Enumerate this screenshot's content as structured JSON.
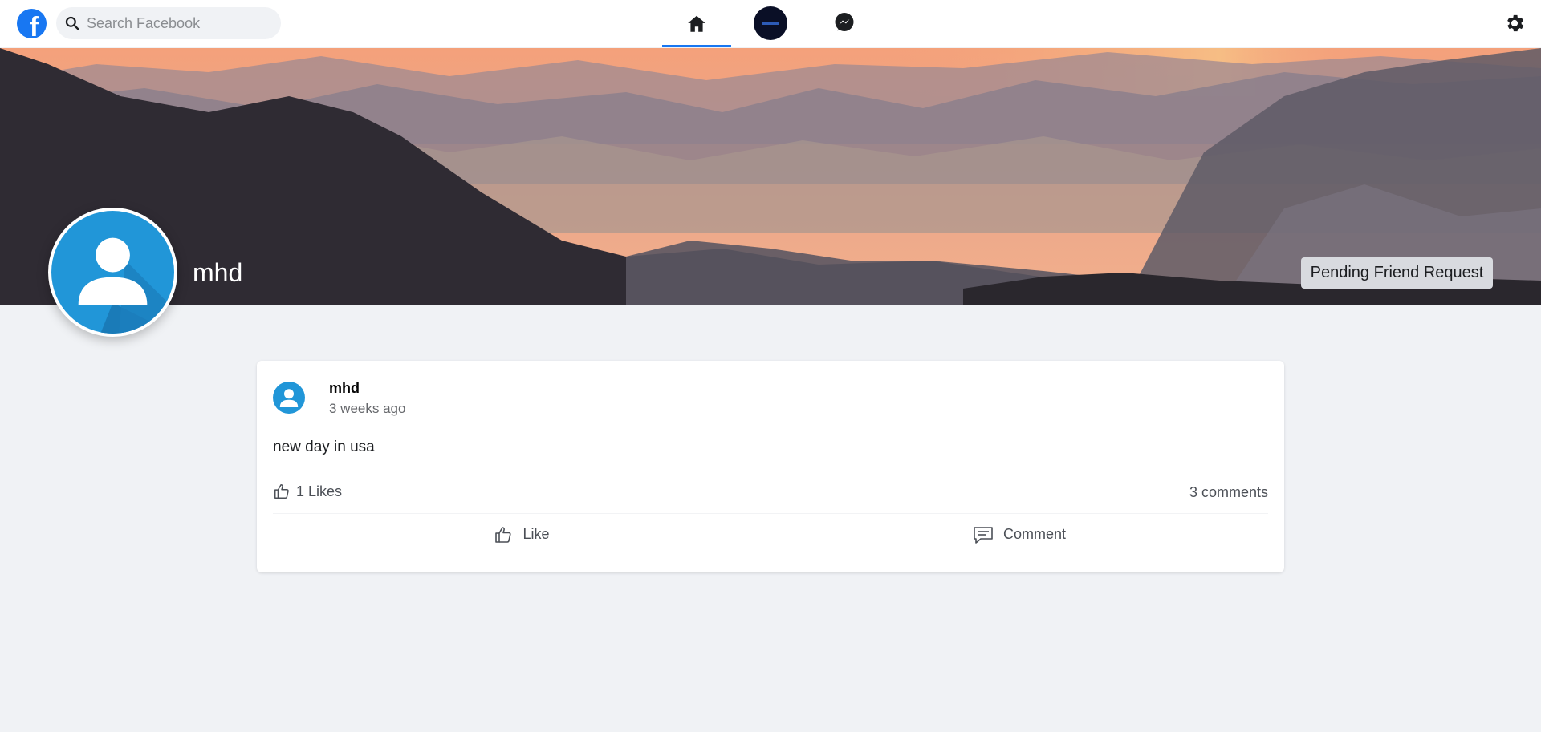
{
  "header": {
    "search_placeholder": "Search Facebook",
    "logo_letter": "f"
  },
  "profile": {
    "name": "mhd",
    "pending_button": "Pending Friend Request"
  },
  "post": {
    "author": "mhd",
    "time": "3 weeks ago",
    "text": "new day in usa",
    "likes_label": "1 Likes",
    "comments_label": "3 comments",
    "like_button": "Like",
    "comment_button": "Comment"
  },
  "colors": {
    "brand": "#1877f2",
    "avatar_blue": "#2196d8",
    "background": "#f0f2f5"
  },
  "icons": [
    "facebook-logo-icon",
    "search-icon",
    "home-icon",
    "messenger-icon",
    "gear-icon",
    "thumbs-up-icon",
    "comment-icon",
    "user-avatar-icon"
  ]
}
